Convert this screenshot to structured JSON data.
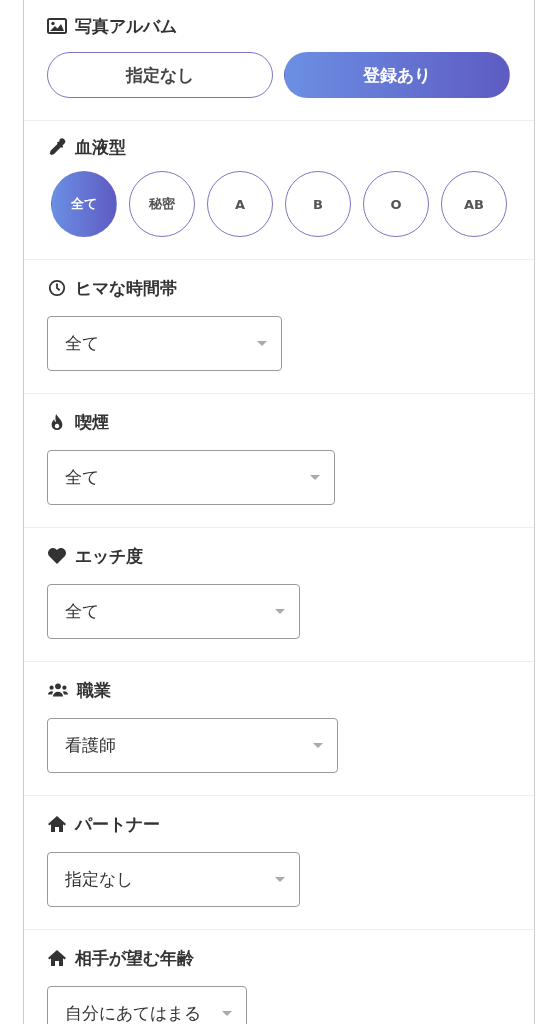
{
  "sections": [
    {
      "kind": "toggle",
      "title": "写真アルバム",
      "options": [
        {
          "label": "指定なし",
          "selected": false
        },
        {
          "label": "登録あり",
          "selected": true
        }
      ]
    },
    {
      "kind": "circles",
      "title": "血液型",
      "options": [
        {
          "label": "全て",
          "selected": true
        },
        {
          "label": "秘密",
          "selected": false
        },
        {
          "label": "A",
          "selected": false
        },
        {
          "label": "B",
          "selected": false
        },
        {
          "label": "O",
          "selected": false
        },
        {
          "label": "AB",
          "selected": false
        }
      ]
    },
    {
      "kind": "select",
      "title": "ヒマな時間帯",
      "value": "全て"
    },
    {
      "kind": "select",
      "title": "喫煙",
      "value": "全て"
    },
    {
      "kind": "select",
      "title": "エッチ度",
      "value": "全て"
    },
    {
      "kind": "select",
      "title": "職業",
      "value": "看護師"
    },
    {
      "kind": "select",
      "title": "パートナー",
      "value": "指定なし"
    },
    {
      "kind": "select",
      "title": "相手が望む年齢",
      "value": "自分にあてはまる"
    }
  ]
}
